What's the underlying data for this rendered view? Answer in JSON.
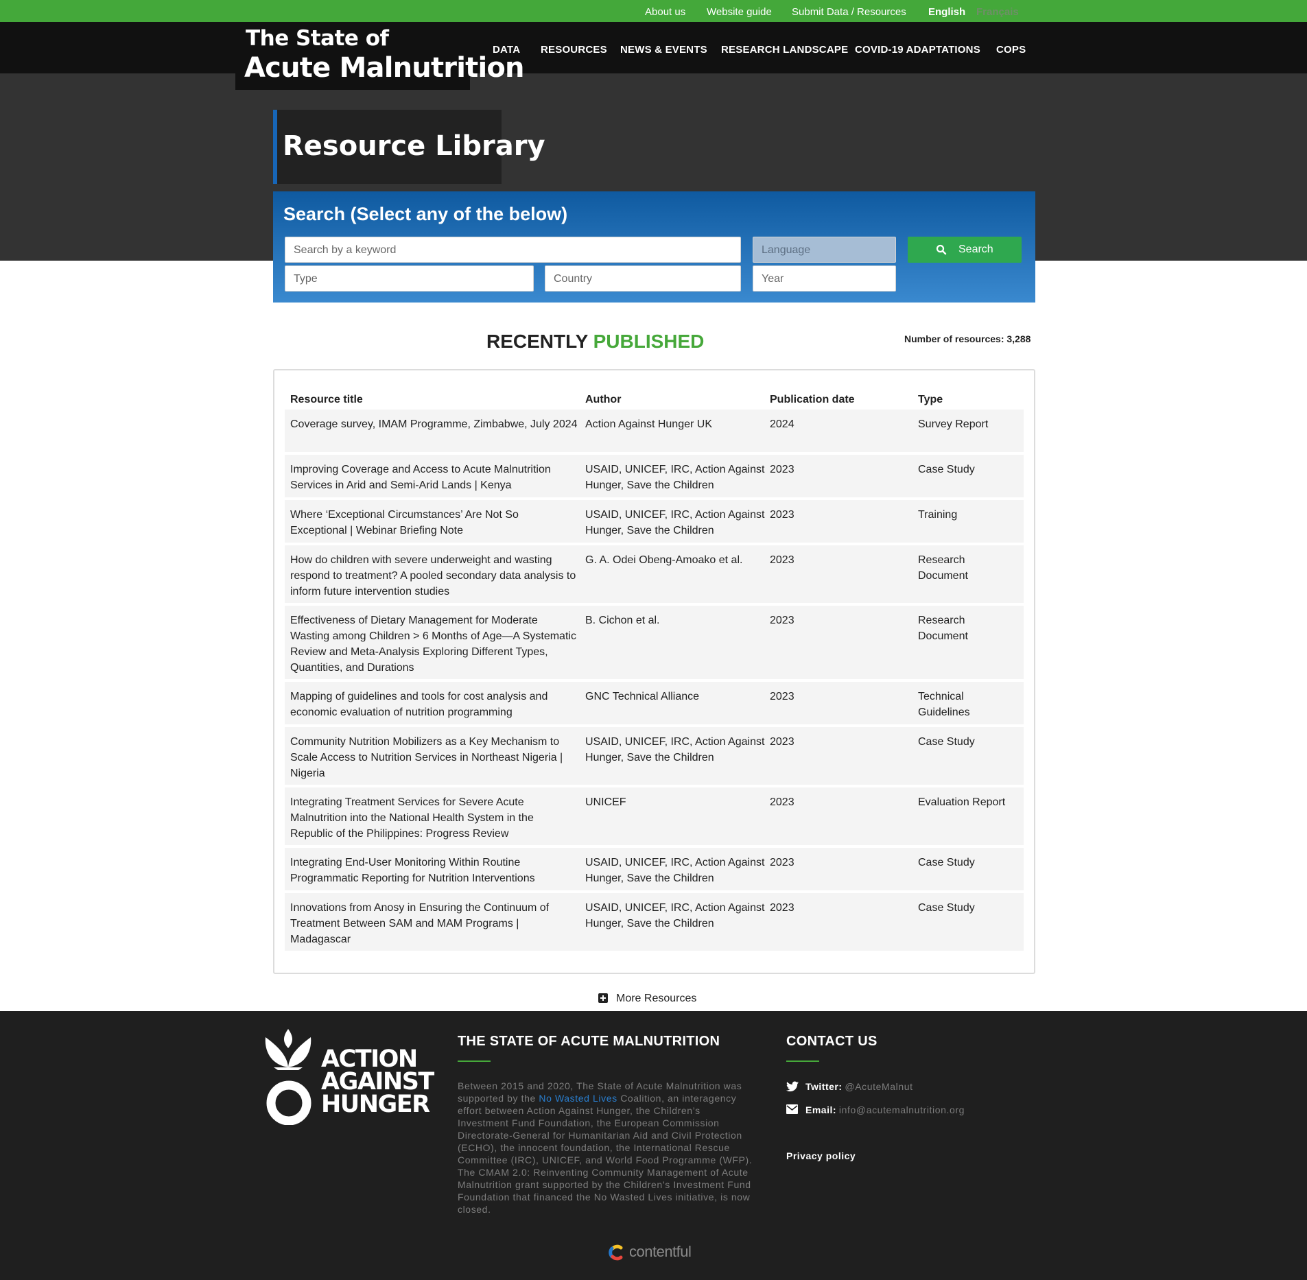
{
  "topbar": {
    "about": "About us",
    "guide": "Website guide",
    "submit": "Submit Data / Resources",
    "lang_en": "English",
    "lang_fr": "Français"
  },
  "logo": {
    "line1": "The State of",
    "line2": "Acute Malnutrition"
  },
  "nav": {
    "data": "DATA",
    "resources": "RESOURCES",
    "news": "NEWS & EVENTS",
    "research": "RESEARCH LANDSCAPE",
    "covid": "COVID-19 ADAPTATIONS",
    "cops": "COPS"
  },
  "page_title": "Resource Library",
  "search": {
    "heading": "Search (Select any of the below)",
    "keyword_placeholder": "Search by a keyword",
    "language": "Language",
    "type": "Type",
    "country": "Country",
    "year": "Year",
    "button": "Search"
  },
  "recent": {
    "title_a": "RECENTLY",
    "title_b": "PUBLISHED",
    "count": "Number of resources: 3,288"
  },
  "table": {
    "headers": [
      "Resource title",
      "Author",
      "Publication date",
      "Type"
    ],
    "rows": [
      [
        "Coverage survey, IMAM Programme, Zimbabwe, July 2024",
        "Action Against Hunger UK",
        "2024",
        "Survey Report"
      ],
      [
        "Improving Coverage and Access to Acute Malnutrition Services in Arid and Semi-Arid Lands | Kenya",
        "USAID, UNICEF, IRC, Action Against Hunger, Save the Children",
        "2023",
        "Case Study"
      ],
      [
        "Where ‘Exceptional Circumstances’ Are Not So Exceptional | Webinar Briefing Note",
        "USAID, UNICEF, IRC, Action Against Hunger, Save the Children",
        "2023",
        "Training"
      ],
      [
        "How do children with severe underweight and wasting respond to treatment? A pooled secondary data analysis to inform future intervention studies",
        "G. A. Odei Obeng-Amoako et al.",
        "2023",
        "Research Document"
      ],
      [
        "Effectiveness of Dietary Management for Moderate Wasting among Children > 6 Months of Age—A Systematic Review and Meta-Analysis Exploring Different Types, Quantities, and Durations",
        "B. Cichon et al.",
        "2023",
        "Research Document"
      ],
      [
        "Mapping of guidelines and tools for cost analysis and economic evaluation of nutrition programming",
        "GNC Technical Alliance",
        "2023",
        "Technical Guidelines"
      ],
      [
        "Community Nutrition Mobilizers as a Key Mechanism to Scale Access to Nutrition Services in Northeast Nigeria | Nigeria",
        "USAID, UNICEF, IRC, Action Against Hunger, Save the Children",
        "2023",
        "Case Study"
      ],
      [
        "Integrating Treatment Services for Severe Acute Malnutrition into the National Health System in the Republic of the Philippines: Progress Review",
        "UNICEF",
        "2023",
        "Evaluation Report"
      ],
      [
        "Integrating End-User Monitoring Within Routine Programmatic Reporting for Nutrition Interventions",
        "USAID, UNICEF, IRC, Action Against Hunger, Save the Children",
        "2023",
        "Case Study"
      ],
      [
        "Innovations from Anosy in Ensuring the Continuum of Treatment Between SAM and MAM Programs | Madagascar",
        "USAID, UNICEF, IRC, Action Against Hunger, Save the Children",
        "2023",
        "Case Study"
      ]
    ]
  },
  "more_resources": "More Resources",
  "footer": {
    "logo_text": [
      "ACTION",
      "AGAINST",
      "HUNGER"
    ],
    "about_heading": "THE STATE OF ACUTE MALNUTRITION",
    "about_p1": "Between 2015 and 2020, The State of Acute Malnutrition was supported by the ",
    "about_link": "No Wasted Lives",
    "about_p2": " Coalition, an interagency effort between Action Against Hunger, the Children’s Investment Fund Foundation, the European Commission Directorate-General for Humanitarian Aid and Civil Protection (ECHO), the innocent foundation, the International Rescue Committee (IRC), UNICEF, and World Food Programme (WFP). The CMAM 2.0: Reinventing Community Management of Acute Malnutrition grant supported by the Children’s Investment Fund Foundation that financed the No Wasted Lives initiative, is now closed.",
    "contact_heading": "CONTACT US",
    "twitter_label": "Twitter:",
    "twitter_value": "@AcuteMalnut",
    "email_label": "Email:",
    "email_value": "info@acutemalnutrition.org",
    "privacy": "Privacy policy",
    "contentful": "contentful"
  }
}
